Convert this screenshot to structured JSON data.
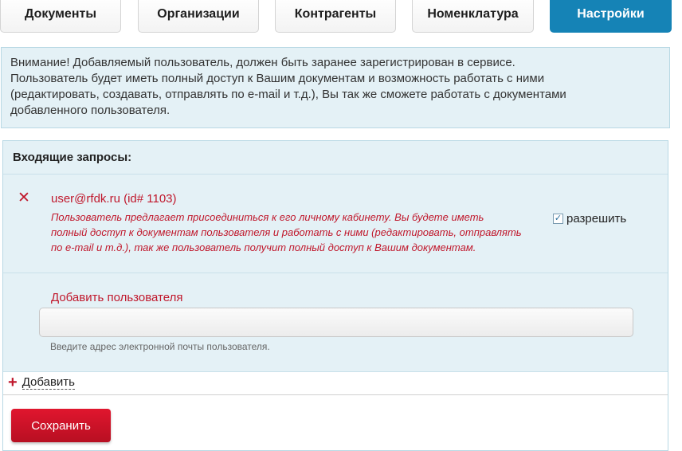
{
  "tabs": {
    "documents": "Документы",
    "organizations": "Организации",
    "contractors": "Контрагенты",
    "nomenclature": "Номенклатура",
    "settings": "Настройки"
  },
  "notice": {
    "line1": "Внимание! Добавляемый пользователь, должен быть заранее зарегистрирован в сервисе.",
    "line2": "Пользователь будет иметь полный доступ к Вашим документам и возможность работать с ними",
    "line3": "(редактировать, создавать, отправлять по e-mail и т.д.), Вы так же сможете работать с документами",
    "line4": "добавленного пользователя."
  },
  "incoming": {
    "title": "Входящие запросы:",
    "reject_icon": "close-icon",
    "user": "user@rfdk.ru (id# 1103)",
    "desc_line1": "Пользователь предлагает присоединиться к его личному кабинету. Вы будете иметь",
    "desc_line2": "полный доступ к документам пользователя и работать с ними (редактировать, отправлять",
    "desc_line3": "по e-mail и т.д.), так же пользователь получит полный доступ к Вашим документам.",
    "allow_label": "разрешить",
    "allow_checked": true
  },
  "add_user": {
    "label": "Добавить пользователя",
    "value": "",
    "placeholder": "",
    "hint": "Введите адрес электронной почты пользователя."
  },
  "actions": {
    "add_label": "Добавить",
    "save_label": "Сохранить"
  },
  "colors": {
    "accent": "#1583b6",
    "danger": "#c0182c",
    "panel_bg": "#e4f1f6"
  }
}
